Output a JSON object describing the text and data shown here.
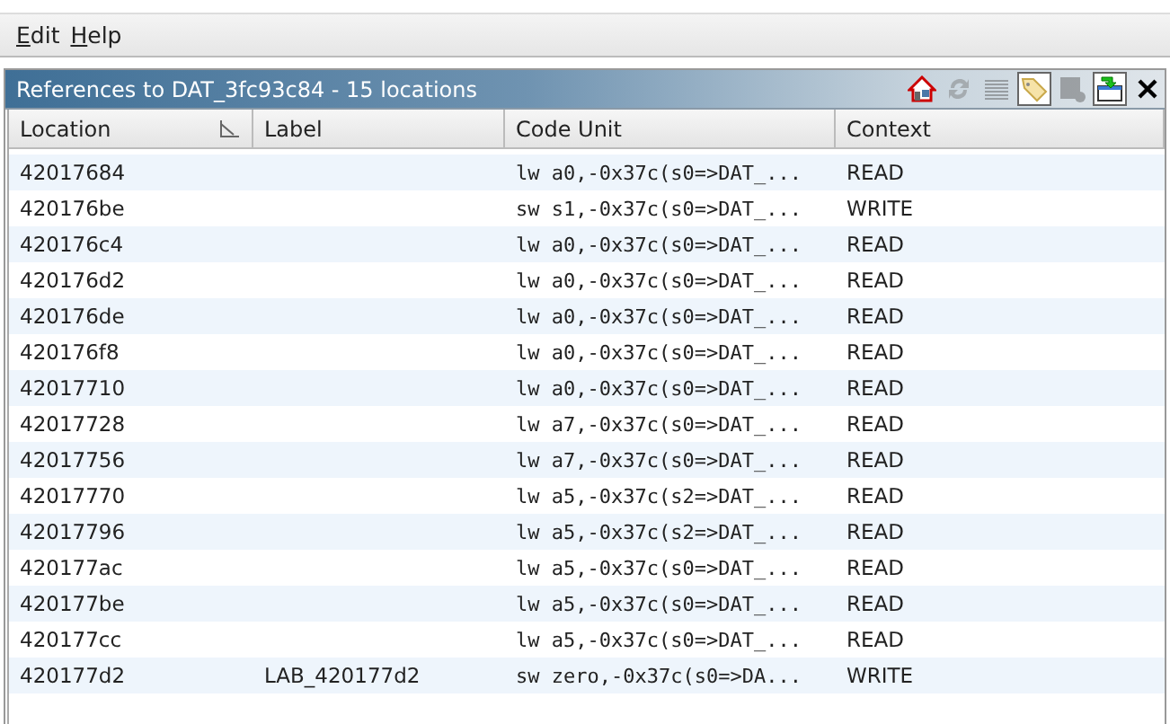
{
  "menu": [
    {
      "label": "Edit"
    },
    {
      "label": "Help"
    }
  ],
  "panel": {
    "title": "References to DAT_3fc93c84 - 15 locations",
    "toolbar": [
      {
        "kind": "home",
        "disabled": false,
        "selected": false
      },
      {
        "kind": "refresh",
        "disabled": true,
        "selected": false
      },
      {
        "kind": "lines",
        "disabled": true,
        "selected": false
      },
      {
        "kind": "tag",
        "disabled": false,
        "selected": true
      },
      {
        "kind": "table",
        "disabled": true,
        "selected": false
      },
      {
        "kind": "export",
        "disabled": false,
        "selected": true
      },
      {
        "kind": "close",
        "disabled": false,
        "selected": false
      }
    ]
  },
  "table": {
    "columns": [
      {
        "label": "Location",
        "sorted": true
      },
      {
        "label": "Label",
        "sorted": false
      },
      {
        "label": "Code Unit",
        "sorted": false
      },
      {
        "label": "Context",
        "sorted": false
      }
    ],
    "rows": [
      {
        "location": "42017684",
        "code": "lw a0,-0x37c(s0=>DAT_...",
        "context": "READ"
      },
      {
        "location": "420176be",
        "code": "sw s1,-0x37c(s0=>DAT_...",
        "context": "WRITE"
      },
      {
        "location": "420176c4",
        "code": "lw a0,-0x37c(s0=>DAT_...",
        "context": "READ"
      },
      {
        "location": "420176d2",
        "code": "lw a0,-0x37c(s0=>DAT_...",
        "context": "READ"
      },
      {
        "location": "420176de",
        "code": "lw a0,-0x37c(s0=>DAT_...",
        "context": "READ"
      },
      {
        "location": "420176f8",
        "code": "lw a0,-0x37c(s0=>DAT_...",
        "context": "READ"
      },
      {
        "location": "42017710",
        "code": "lw a0,-0x37c(s0=>DAT_...",
        "context": "READ"
      },
      {
        "location": "42017728",
        "code": "lw a7,-0x37c(s0=>DAT_...",
        "context": "READ"
      },
      {
        "location": "42017756",
        "code": "lw a7,-0x37c(s0=>DAT_...",
        "context": "READ"
      },
      {
        "location": "42017770",
        "code": "lw a5,-0x37c(s2=>DAT_...",
        "context": "READ"
      },
      {
        "location": "42017796",
        "code": "lw a5,-0x37c(s2=>DAT_...",
        "context": "READ"
      },
      {
        "location": "420177ac",
        "code": "lw a5,-0x37c(s0=>DAT_...",
        "context": "READ"
      },
      {
        "location": "420177be",
        "code": "lw a5,-0x37c(s0=>DAT_...",
        "context": "READ"
      },
      {
        "location": "420177cc",
        "code": "lw a5,-0x37c(s0=>DAT_...",
        "context": "READ"
      },
      {
        "location": "420177d2",
        "label": "LAB_420177d2",
        "code": "sw zero,-0x37c(s0=>DA...",
        "context": "WRITE"
      }
    ]
  }
}
